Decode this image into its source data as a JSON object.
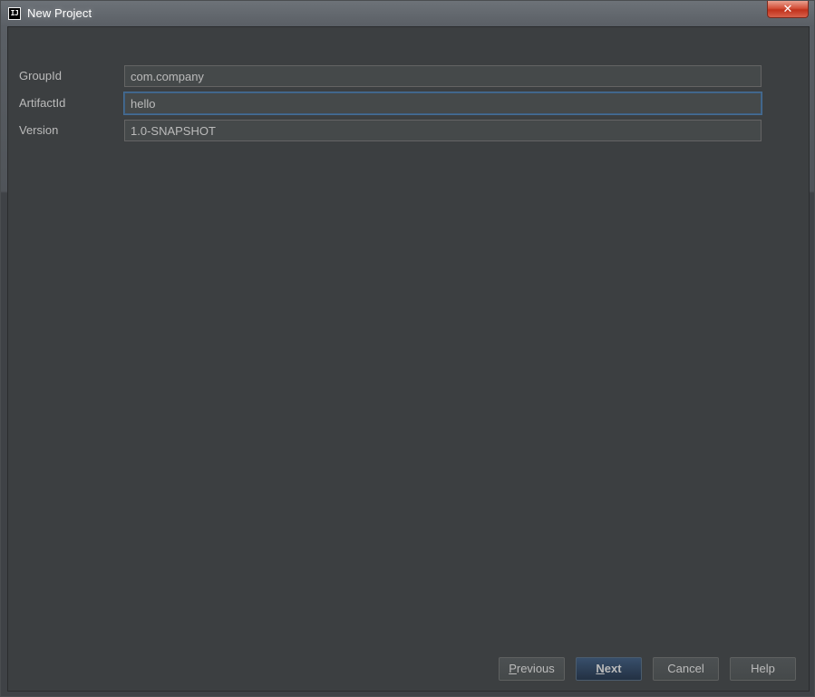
{
  "window": {
    "title": "New Project",
    "app_icon_text": "IJ",
    "close_label": "✕"
  },
  "form": {
    "fields": [
      {
        "label": "GroupId",
        "value": "com.company"
      },
      {
        "label": "ArtifactId",
        "value": "hello"
      },
      {
        "label": "Version",
        "value": "1.0-SNAPSHOT"
      }
    ]
  },
  "buttons": {
    "previous": {
      "mnemonic": "P",
      "rest": "revious"
    },
    "next": {
      "mnemonic": "N",
      "rest": "ext"
    },
    "cancel": "Cancel",
    "help": "Help"
  },
  "colors": {
    "background": "#3c3f41",
    "field_bg": "#45494a",
    "text": "#bbbbbb",
    "focus_border": "#466d94",
    "default_button": "#2f4156"
  }
}
